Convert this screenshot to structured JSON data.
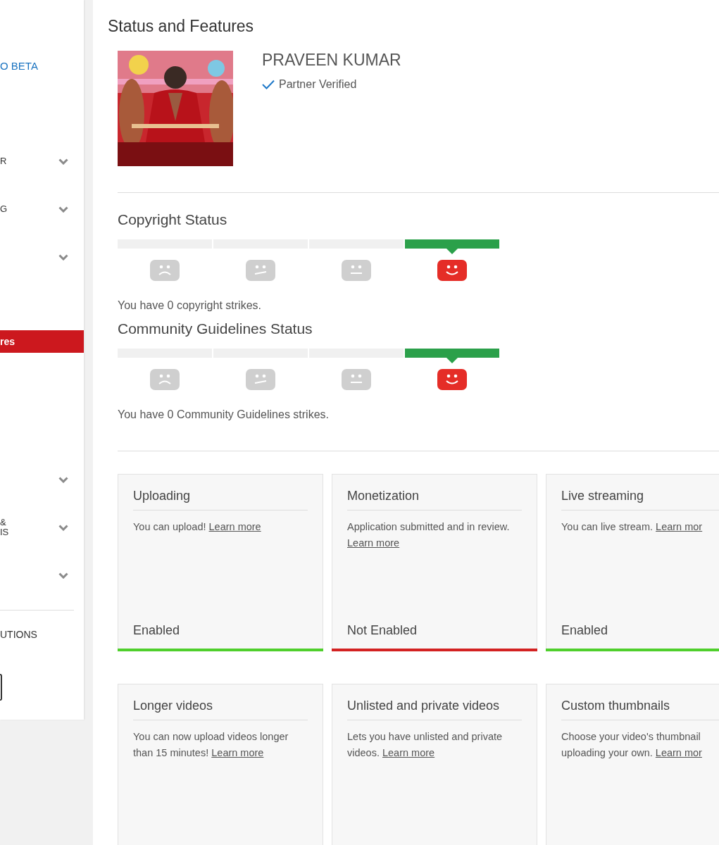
{
  "sidebar": {
    "items": [
      {
        "kind": "link",
        "label": "O BETA",
        "selected": false
      },
      {
        "kind": "group",
        "label": "R",
        "selected": false
      },
      {
        "kind": "group",
        "label": "G",
        "selected": false
      },
      {
        "kind": "group",
        "selected": false
      },
      {
        "kind": "page",
        "label": "res",
        "selected": true
      },
      {
        "kind": "group",
        "selected": false
      },
      {
        "kind": "group",
        "label": "&\nIS",
        "selected": false
      },
      {
        "kind": "group",
        "selected": false
      },
      {
        "kind": "heading",
        "label": "UTIONS",
        "selected": false
      },
      {
        "kind": "button",
        "selected": false
      }
    ]
  },
  "page_title": "Status and Features",
  "profile": {
    "name": "PRAVEEN KUMAR",
    "badge": "Partner Verified"
  },
  "statuses": [
    {
      "title": "Copyright Status",
      "faces": [
        {
          "kind": "sad",
          "selected": false
        },
        {
          "kind": "uneasy",
          "selected": false
        },
        {
          "kind": "neutral",
          "selected": false
        },
        {
          "kind": "happy",
          "selected": true
        }
      ],
      "summary": "You have 0 copyright strikes."
    },
    {
      "title": "Community Guidelines Status",
      "faces": [
        {
          "kind": "sad",
          "selected": false
        },
        {
          "kind": "uneasy",
          "selected": false
        },
        {
          "kind": "neutral",
          "selected": false
        },
        {
          "kind": "happy",
          "selected": true
        }
      ],
      "summary": "You have 0 Community Guidelines strikes."
    }
  ],
  "features": [
    {
      "title": "Uploading",
      "text": "You can upload!",
      "link": "Learn more",
      "status": "Enabled",
      "enabled": true
    },
    {
      "title": "Monetization",
      "text": "Application submitted and in review.",
      "link": "Learn more",
      "status": "Not Enabled",
      "enabled": false
    },
    {
      "title": "Live streaming",
      "text": "You can live stream.",
      "link": "Learn mor",
      "status": "Enabled",
      "enabled": true
    },
    {
      "title": "Longer videos",
      "text": "You can now upload videos longer than 15 minutes!",
      "link": "Learn more"
    },
    {
      "title": "Unlisted and private videos",
      "text": "Lets you have unlisted and private videos.",
      "link": "Learn more"
    },
    {
      "title": "Custom thumbnails",
      "text": "Choose your video's thumbnail uploading your own.",
      "link": "Learn mor"
    }
  ]
}
